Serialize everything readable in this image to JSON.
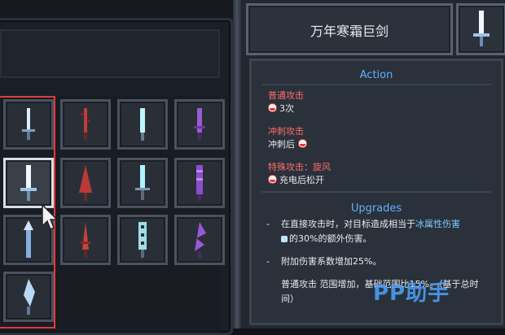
{
  "weapon": {
    "name": "万年寒霜巨剑"
  },
  "action": {
    "title": "Action",
    "moves": [
      {
        "name": "普通攻击",
        "input": "3次"
      },
      {
        "name": "冲刺攻击",
        "input": "冲刺后"
      },
      {
        "name": "特殊攻击：旋风",
        "input": "充电后松开"
      }
    ]
  },
  "upgrades": {
    "title": "Upgrades",
    "bullet": "-",
    "items": [
      {
        "pre": "在直接攻击时，对目标造成相当于",
        "highlight": "冰属性伤害",
        "post": "的30%的额外伤害。"
      },
      {
        "pre": "附加伤害系数增加25%。",
        "highlight": "",
        "post": ""
      }
    ],
    "extra": "普通攻击 范围增加，基础范围比15%。（基于总时间）"
  },
  "watermark": "PP助手",
  "colors": {
    "accent": "#5fb0ff",
    "label_red": "#ff6b6b",
    "selection": "#e03a3a"
  },
  "inventory": {
    "selected_index": 4,
    "slots": [
      "ice-sword-icon",
      "red-serrated-sword-icon",
      "cyan-sword-icon",
      "purple-sword-icon",
      "frost-greatsword-icon",
      "red-thorn-sword-icon",
      "cyan-longsword-icon",
      "purple-twisted-sword-icon",
      "blue-spear-icon",
      "red-spike-sword-icon",
      "chain-sword-icon",
      "purple-jagged-sword-icon",
      "ice-crystal-sword-icon"
    ]
  }
}
